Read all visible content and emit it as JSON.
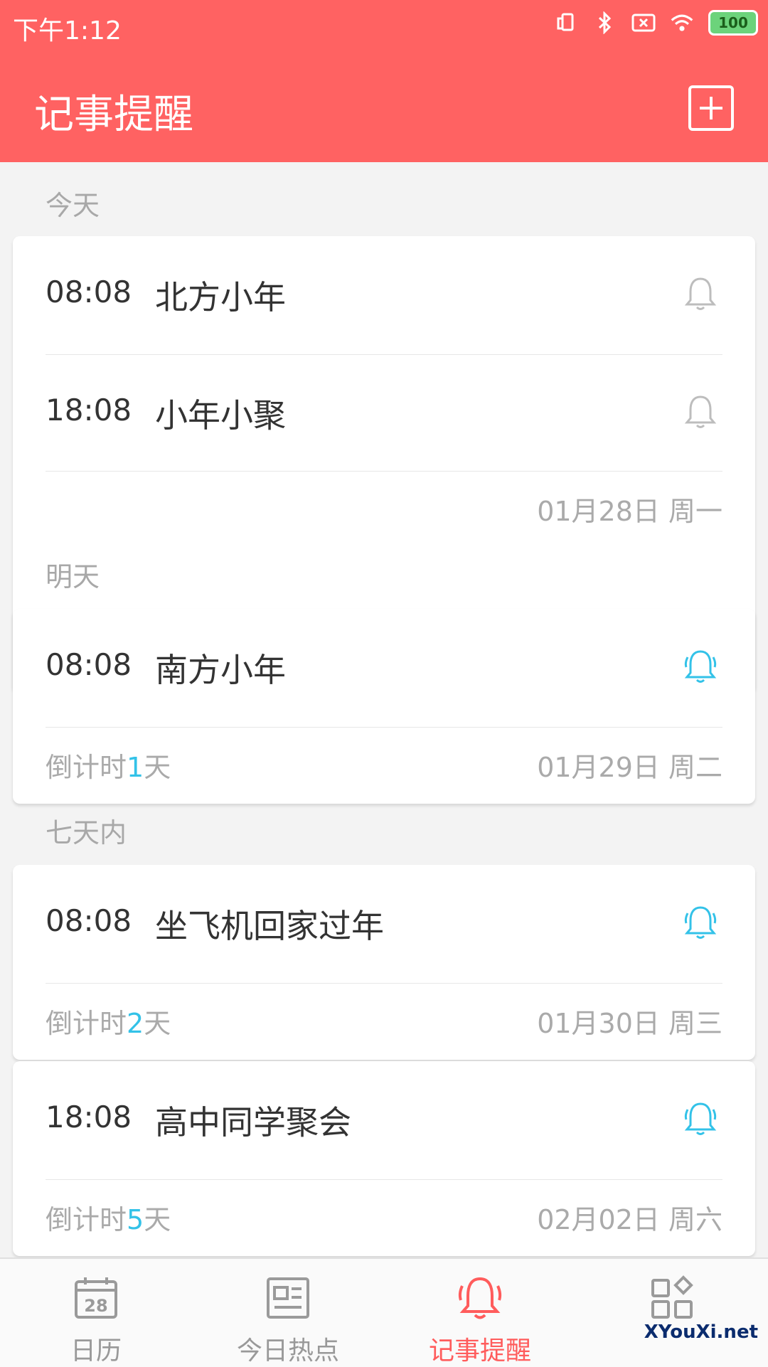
{
  "status": {
    "time": "下午1:12",
    "battery": "100",
    "icons": [
      "vibrate-icon",
      "bluetooth-icon",
      "sim-icon",
      "wifi-icon",
      "battery-icon"
    ]
  },
  "header": {
    "title": "记事提醒",
    "add_icon": "plus-icon"
  },
  "colors": {
    "accent": "#ff6262",
    "active_bell": "#33c2e8",
    "inactive_bell": "#bdbdbd",
    "countdown_number": "#33c2e8"
  },
  "sections": [
    {
      "label": "今天",
      "items": [
        {
          "time": "08:08",
          "title": "北方小年",
          "bell": "inactive"
        },
        {
          "time": "18:08",
          "title": "小年小聚",
          "bell": "inactive"
        }
      ],
      "footer": {
        "date": "01月28日 周一"
      }
    },
    {
      "label": "明天",
      "items": [
        {
          "time": "08:08",
          "title": "南方小年",
          "bell": "active"
        }
      ],
      "footer": {
        "cd_prefix": "倒计时",
        "cd_num": "1",
        "cd_suffix": "天",
        "date": "01月29日 周二"
      }
    },
    {
      "label": "七天内",
      "cards": [
        {
          "items": [
            {
              "time": "08:08",
              "title": "坐飞机回家过年",
              "bell": "active"
            }
          ],
          "footer": {
            "cd_prefix": "倒计时",
            "cd_num": "2",
            "cd_suffix": "天",
            "date": "01月30日 周三"
          }
        },
        {
          "items": [
            {
              "time": "18:08",
              "title": "高中同学聚会",
              "bell": "active"
            }
          ],
          "footer": {
            "cd_prefix": "倒计时",
            "cd_num": "5",
            "cd_suffix": "天",
            "date": "02月02日 周六"
          }
        }
      ]
    }
  ],
  "tabbar": {
    "tabs": [
      {
        "label": "日历",
        "icon": "calendar-icon",
        "calendar_day": "28",
        "active": false
      },
      {
        "label": "今日热点",
        "icon": "news-icon",
        "active": false
      },
      {
        "label": "记事提醒",
        "icon": "bell-icon",
        "active": true
      },
      {
        "label": "",
        "icon": "apps-icon",
        "active": false
      }
    ]
  },
  "watermark": "XYouXi.net"
}
